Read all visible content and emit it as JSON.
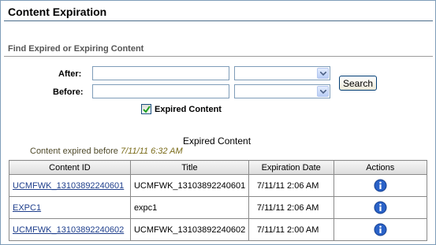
{
  "page": {
    "title": "Content Expiration"
  },
  "search": {
    "section_title": "Find Expired or Expiring Content",
    "after_label": "After:",
    "before_label": "Before:",
    "after_value": "",
    "before_value": "",
    "after_time": "",
    "before_time": "",
    "search_button": "Search",
    "expired_checkbox_label": "Expired Content",
    "expired_checked": true
  },
  "results": {
    "caption": "Expired Content",
    "note_prefix": "Content expired before",
    "note_date": "7/11/11 6:32 AM",
    "columns": [
      "Content ID",
      "Title",
      "Expiration Date",
      "Actions"
    ],
    "rows": [
      {
        "content_id": "UCMFWK_13103892240601",
        "title": "UCMFWK_13103892240601",
        "expiration": "7/11/11 2:06 AM",
        "action_icon": "info-icon"
      },
      {
        "content_id": "EXPC1",
        "title": "expc1",
        "expiration": "7/11/11 2:06 AM",
        "action_icon": "info-icon"
      },
      {
        "content_id": "UCMFWK_13103892240602",
        "title": "UCMFWK_13103892240602",
        "expiration": "7/11/11 2:00 AM",
        "action_icon": "info-icon"
      }
    ]
  },
  "colors": {
    "link": "#1f3f8c",
    "note_date": "#7a6b19",
    "info_icon": "#2a62c8"
  }
}
